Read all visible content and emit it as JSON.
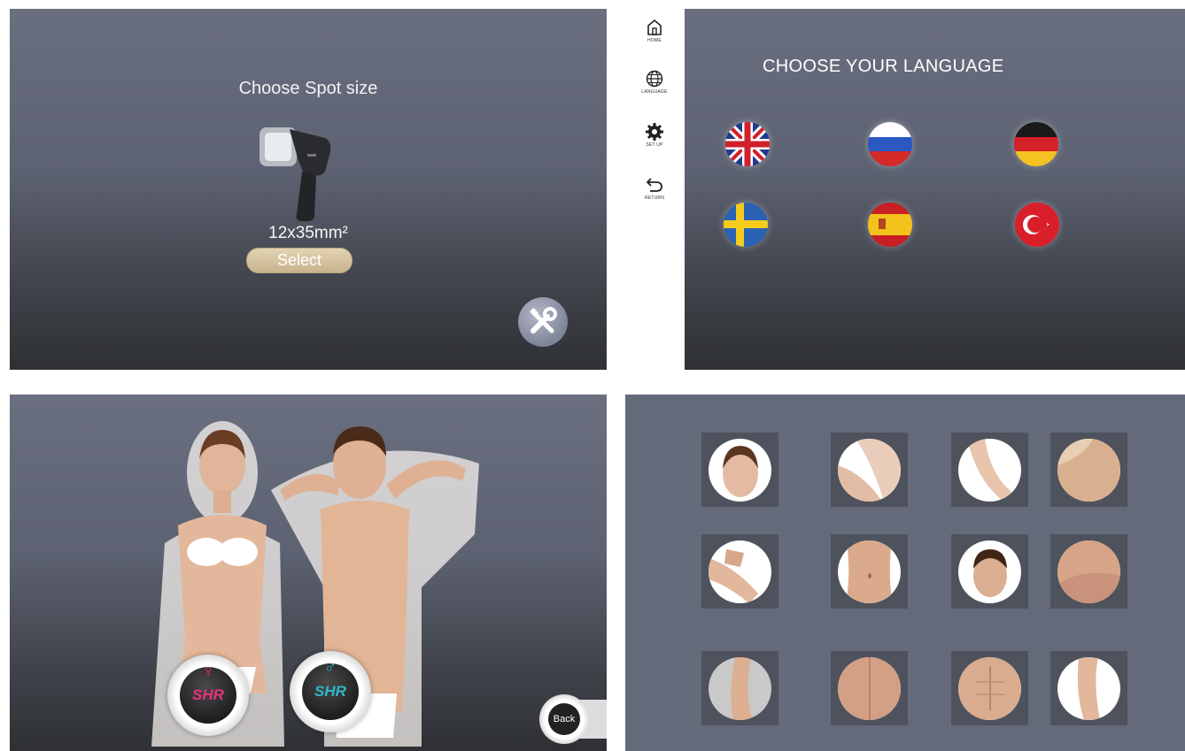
{
  "spot_panel": {
    "title": "Choose Spot size",
    "spot_size": "12x35mm²",
    "select_label": "Select",
    "tools_icon": "tools-icon"
  },
  "language_panel": {
    "sidebar": [
      {
        "label": "HOME",
        "icon": "home-icon"
      },
      {
        "label": "LANGUAGE",
        "icon": "globe-icon"
      },
      {
        "label": "SET UP",
        "icon": "gear-icon"
      },
      {
        "label": "RETURN",
        "icon": "return-icon"
      }
    ],
    "title": "CHOOSE YOUR LANGUAGE",
    "flags": [
      "uk-flag",
      "russia-flag",
      "germany-flag",
      "sweden-flag",
      "spain-flag",
      "turkey-flag"
    ]
  },
  "gender_panel": {
    "female_label": "SHR",
    "male_label": "SHR",
    "back_label": "Back"
  },
  "body_area_panel": {
    "areas": [
      "face",
      "underarm",
      "arm",
      "back",
      "leg",
      "abdomen",
      "male-face",
      "shoulder",
      "lower-leg",
      "lower-back",
      "chest",
      "thigh"
    ]
  },
  "colors": {
    "accent_female": "#e6337d",
    "accent_male": "#2fb7c8",
    "select_gold": "#d6c3a0"
  }
}
